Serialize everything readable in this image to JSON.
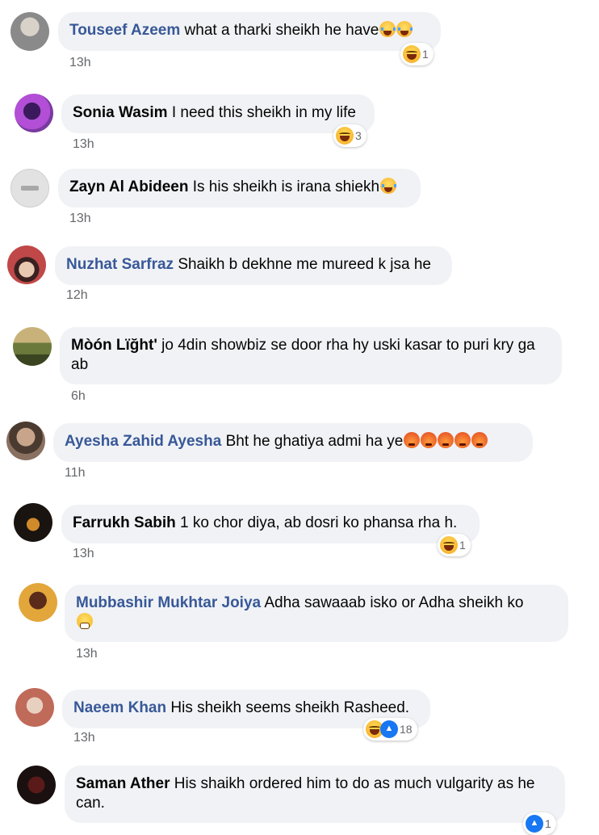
{
  "comments": [
    {
      "author": "Touseef Azeem",
      "text": "what a tharki sheikh he have",
      "time": "13h",
      "inline_emojis": [
        "joy-icon",
        "joy-icon"
      ],
      "reaction_icons": [
        "haha-icon"
      ],
      "reaction_count": "1",
      "avatar_colors": [
        "#8a8a8a",
        "#d8d2c8"
      ]
    },
    {
      "author": "Sonia Wasim",
      "text": "I need this sheikh in my life",
      "time": "13h",
      "inline_emojis": [],
      "reaction_icons": [
        "haha-icon"
      ],
      "reaction_count": "3",
      "avatar_colors": [
        "#b24fd6",
        "#3a1a5c"
      ]
    },
    {
      "author": "Zayn Al Abideen",
      "text": "Is his sheikh is irana shiekh",
      "time": "13h",
      "inline_emojis": [
        "joy-icon"
      ],
      "reaction_icons": [],
      "reaction_count": "",
      "avatar_colors": [
        "#e2e2e2",
        "#c8c8c8"
      ]
    },
    {
      "author": "Nuzhat Sarfraz",
      "text": "Shaikh b dekhne me mureed k jsa he",
      "time": "12h",
      "inline_emojis": [],
      "reaction_icons": [],
      "reaction_count": "",
      "avatar_colors": [
        "#c04848",
        "#3a2020"
      ]
    },
    {
      "author": "Mòón Lïğht'",
      "text": "jo 4din showbiz se door rha hy uski kasar to puri kry ga ab",
      "time": "6h",
      "inline_emojis": [],
      "reaction_icons": [],
      "reaction_count": "",
      "avatar_colors": [
        "#6b7a3a",
        "#c9b27a"
      ]
    },
    {
      "author": "Ayesha Zahid Ayesha",
      "text": "Bht he ghatiya admi ha ye",
      "time": "11h",
      "inline_emojis": [
        "angry-icon",
        "angry-icon",
        "angry-icon",
        "angry-icon",
        "angry-icon"
      ],
      "reaction_icons": [],
      "reaction_count": "",
      "avatar_colors": [
        "#c8a58a",
        "#4a3a30"
      ]
    },
    {
      "author": "Farrukh Sabih",
      "text": "1 ko chor diya, ab dosri ko phansa rha h.",
      "time": "13h",
      "inline_emojis": [],
      "reaction_icons": [
        "haha-icon"
      ],
      "reaction_count": "1",
      "avatar_colors": [
        "#d08a2a",
        "#1a1410"
      ]
    },
    {
      "author": "Mubbashir Mukhtar Joiya",
      "text": "Adha sawaaab isko or Adha sheikh ko",
      "time": "13h",
      "inline_emojis": [
        "grimace-icon"
      ],
      "reaction_icons": [],
      "reaction_count": "",
      "avatar_colors": [
        "#e2a63a",
        "#5a2a1a"
      ]
    },
    {
      "author": "Naeem Khan",
      "text": "His sheikh seems sheikh Rasheed.",
      "time": "13h",
      "inline_emojis": [],
      "reaction_icons": [
        "haha-icon",
        "like-icon"
      ],
      "reaction_count": "18",
      "avatar_colors": [
        "#c06a5a",
        "#e8d0c0"
      ]
    },
    {
      "author": "Saman Ather",
      "text": "His shaikh ordered him to do as much vulgarity as he can.",
      "time": "",
      "inline_emojis": [],
      "reaction_icons": [
        "like-icon"
      ],
      "reaction_count": "1",
      "avatar_colors": [
        "#5a1a1a",
        "#1a1010"
      ]
    }
  ]
}
